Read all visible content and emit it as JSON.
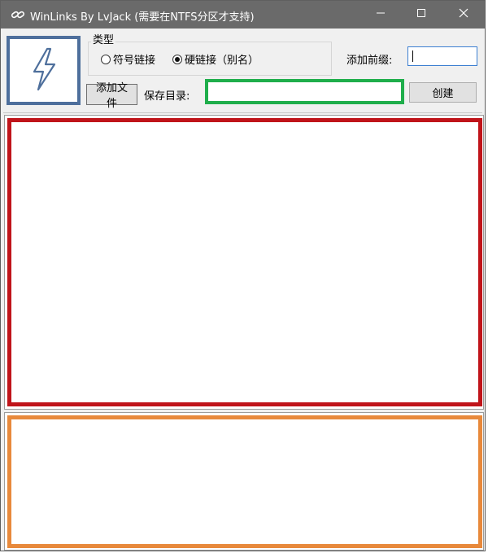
{
  "window": {
    "title": "WinLinks By LvJack (需要在NTFS分区才支持)"
  },
  "titlebar": {
    "icons": [
      "link-icon",
      "minimize-icon",
      "maximize-icon",
      "close-icon"
    ]
  },
  "logo": {
    "icon": "lightning-bolt-icon",
    "color": "#4e6f9c"
  },
  "type_group": {
    "title": "类型",
    "options": [
      {
        "label": "符号链接",
        "checked": false
      },
      {
        "label": "硬链接（别名）",
        "checked": true
      }
    ]
  },
  "prefix": {
    "label": "添加前缀:",
    "value": ""
  },
  "toolbar": {
    "add_file_label": "添加文件",
    "save_dir_label": "保存目录:",
    "save_dir_value": "",
    "create_label": "创建"
  },
  "highlights": {
    "save_dir_border": "#1fae4b",
    "file_list_border": "#c0141a",
    "log_area_border": "#e8893b"
  }
}
